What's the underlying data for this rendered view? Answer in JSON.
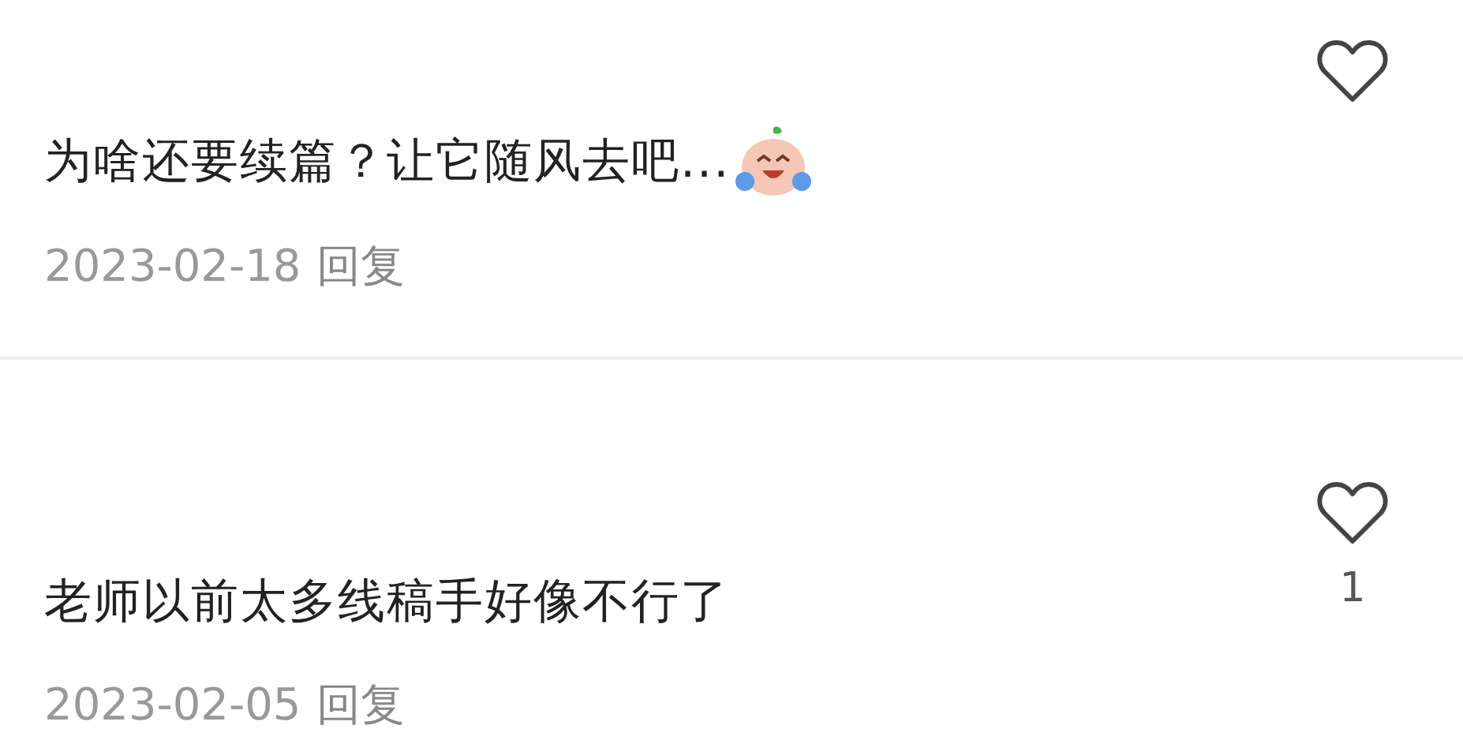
{
  "comments": [
    {
      "text": "为啥还要续篇？让它随风去吧...",
      "emoji": {
        "kind": "laughing-tears"
      },
      "date": "2023-02-18",
      "reply": "回复"
    },
    {
      "text": "老师以前太多线稿手好像不行了",
      "date": "2023-02-05",
      "reply": "回复",
      "likes": "1"
    }
  ]
}
